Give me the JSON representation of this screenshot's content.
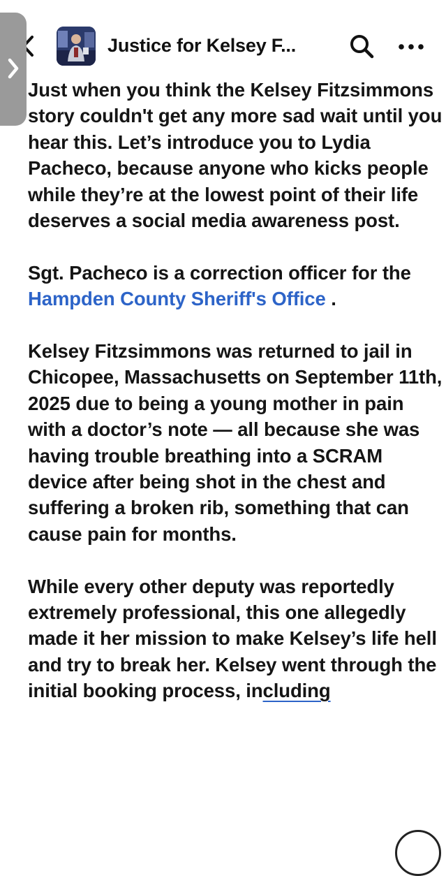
{
  "header": {
    "title": "Justice for Kelsey F...",
    "back_icon": "chevron-left-icon",
    "search_icon": "search-icon",
    "more_icon": "more-horizontal-icon"
  },
  "post": {
    "paragraphs": {
      "p1": "Just when you think the Kelsey Fitzsimmons story couldn't get any more sad wait until you hear this. Let’s introduce you to Lydia Pacheco, because anyone who kicks people while they’re at the lowest point of their life deserves a social media awareness post.",
      "p2_before": "Sgt. Pacheco is a correction officer for the ",
      "p2_mention": "Hampden County Sheriff's Office",
      "p2_after": " .",
      "p3": "Kelsey Fitzsimmons was returned to jail in Chicopee, Massachusetts on September 11th, 2025 due to being a young mother in pain with a doctor’s note — all because she was having trouble breathing into a SCRAM device after being shot in the chest and suffering a broken rib, something that can cause pain for months.",
      "p4_before": "While every other deputy was reportedly extremely professional, this one allegedly made it her mission to make Kelsey’s life hell and try to break her. Kelsey went through the initial booking process, in",
      "p4_link": "cluding"
    }
  },
  "colors": {
    "mention": "#2d64c8",
    "text": "#151515",
    "edge_tab": "#9a9a9a"
  }
}
